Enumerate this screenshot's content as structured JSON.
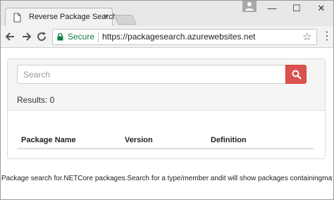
{
  "browser": {
    "tab_title": "Reverse Package Search",
    "tab_close": "×",
    "security_label": "Secure",
    "url": "https://packagesearch.azurewebsites.net",
    "window_controls": {
      "minimize": "—",
      "maximize": "☐",
      "close": "✕"
    },
    "icons": [
      "page-icon",
      "tab-close-icon",
      "new-tab-icon",
      "profile-icon",
      "back-icon",
      "forward-icon",
      "reload-icon",
      "lock-icon",
      "star-icon",
      "menu-icon"
    ]
  },
  "page": {
    "search": {
      "placeholder": "Search",
      "value": "",
      "button_icon": "search-icon",
      "button_color": "#d9534f"
    },
    "results_label": "Results: 0",
    "table_headers": [
      "Package Name",
      "Version",
      "Definition"
    ],
    "footer_text": "Package search for.NETCore packages.Search for a type/member andit will show packages containingmatc"
  }
}
